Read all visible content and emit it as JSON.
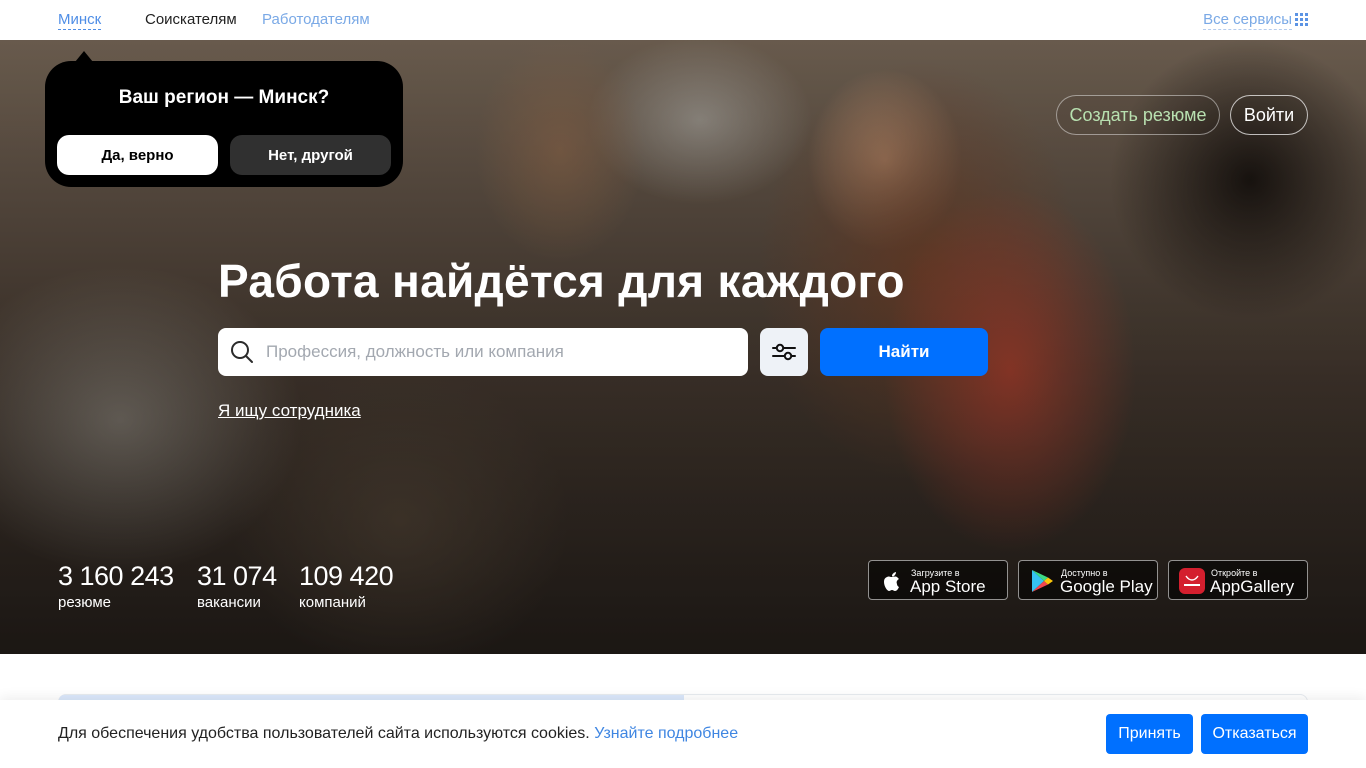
{
  "nav": {
    "region": "Минск",
    "seekers": "Соискателям",
    "employers": "Работодателям",
    "all_services": "Все сервисы",
    "all_services_icon": "grid-icon"
  },
  "region_popup": {
    "question": "Ваш регион — Минск?",
    "yes_label": "Да, верно",
    "no_label": "Нет, другой"
  },
  "auth": {
    "create_resume": "Создать резюме",
    "login": "Войти"
  },
  "hero": {
    "headline": "Работа найдётся для каждого",
    "search_placeholder": "Профессия, должность или компания",
    "search_value": "",
    "search_icon": "search-icon",
    "filter_icon": "sliders-icon",
    "find_label": "Найти",
    "employer_link": "Я ищу сотрудника"
  },
  "stats": [
    {
      "value": "3 160 243",
      "label": "резюме"
    },
    {
      "value": "31 074",
      "label": "вакансии"
    },
    {
      "value": "109 420",
      "label": "компаний"
    }
  ],
  "stores": [
    {
      "small": "Загрузите в",
      "big": "App Store",
      "icon": "apple-icon"
    },
    {
      "small": "Доступно в",
      "big": "Google Play",
      "icon": "google-play-icon"
    },
    {
      "small": "Откройте в",
      "big": "AppGallery",
      "icon": "huawei-icon"
    }
  ],
  "cookie": {
    "text": "Для обеспечения удобства пользователей сайта используются cookies.",
    "link": "Узнайте подробнее",
    "accept": "Принять",
    "decline": "Отказаться"
  },
  "colors": {
    "accent": "#0070ff",
    "link": "#4f8ee6",
    "popup_bg": "#000000"
  }
}
